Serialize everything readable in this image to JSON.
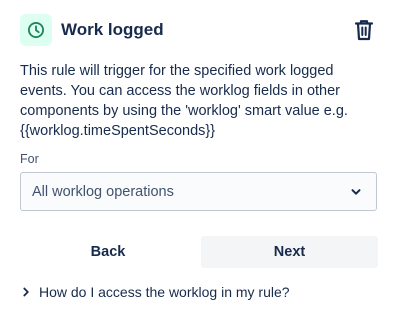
{
  "header": {
    "title": "Work logged",
    "icon": "clock-icon",
    "delete_icon": "trash-icon"
  },
  "description": {
    "lines": [
      "This rule will trigger for the specified work logged",
      "events. You can access the worklog fields in other",
      "components by using the 'worklog' smart value e.g.",
      "{{worklog.timeSpentSeconds}}"
    ]
  },
  "field": {
    "label": "For",
    "selected_value": "All worklog operations"
  },
  "buttons": {
    "back_label": "Back",
    "next_label": "Next"
  },
  "help": {
    "link_text": "How do I access the worklog in my rule?"
  },
  "colors": {
    "icon_tile_bg": "#dcfff1",
    "icon_stroke": "#1f845a",
    "text_primary": "#172b4d",
    "text_secondary": "#42526e",
    "next_button_bg": "#f4f5f7",
    "select_border": "#c1c7d0"
  }
}
